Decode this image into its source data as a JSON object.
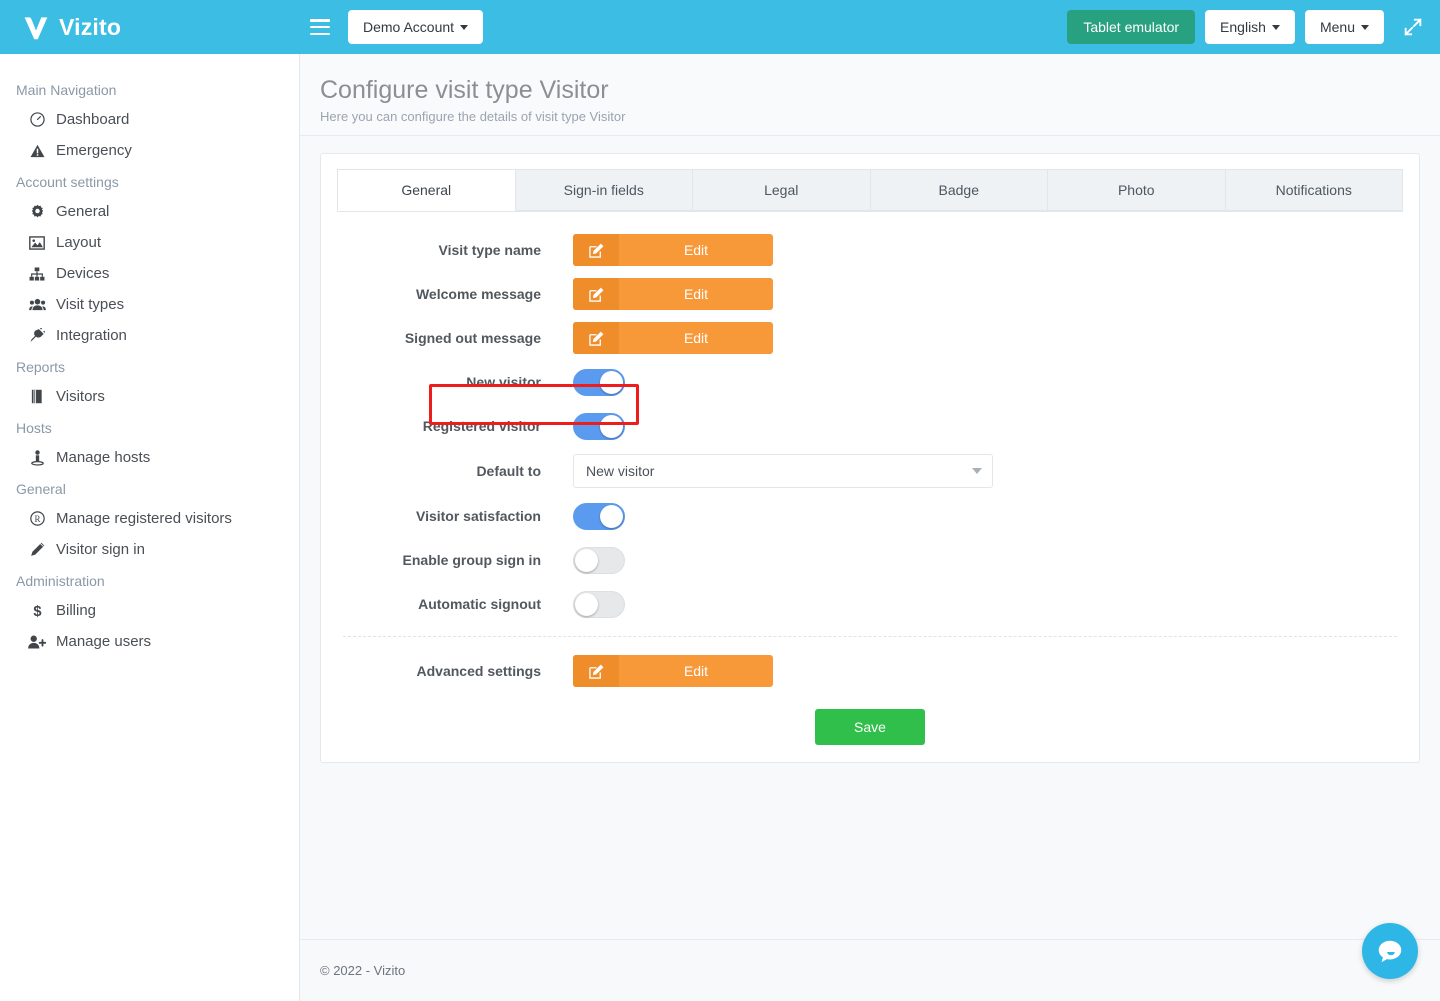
{
  "topbar": {
    "brand": "Vizito",
    "account_label": "Demo Account",
    "emulator_label": "Tablet emulator",
    "language_label": "English",
    "menu_label": "Menu"
  },
  "sidebar": {
    "groups": [
      {
        "heading": "Main Navigation",
        "items": [
          {
            "label": "Dashboard",
            "icon": "dashboard-icon"
          },
          {
            "label": "Emergency",
            "icon": "warning-icon"
          }
        ]
      },
      {
        "heading": "Account settings",
        "items": [
          {
            "label": "General",
            "icon": "gear-icon"
          },
          {
            "label": "Layout",
            "icon": "image-icon"
          },
          {
            "label": "Devices",
            "icon": "sitemap-icon"
          },
          {
            "label": "Visit types",
            "icon": "users-icon"
          },
          {
            "label": "Integration",
            "icon": "plug-icon"
          }
        ]
      },
      {
        "heading": "Reports",
        "items": [
          {
            "label": "Visitors",
            "icon": "book-icon"
          }
        ]
      },
      {
        "heading": "Hosts",
        "items": [
          {
            "label": "Manage hosts",
            "icon": "person-icon"
          }
        ]
      },
      {
        "heading": "General",
        "items": [
          {
            "label": "Manage registered visitors",
            "icon": "registered-icon"
          },
          {
            "label": "Visitor sign in",
            "icon": "pencil-icon"
          }
        ]
      },
      {
        "heading": "Administration",
        "items": [
          {
            "label": "Billing",
            "icon": "dollar-icon"
          },
          {
            "label": "Manage users",
            "icon": "user-plus-icon"
          }
        ]
      }
    ]
  },
  "page": {
    "title": "Configure visit type Visitor",
    "subtitle": "Here you can configure the details of visit type Visitor"
  },
  "tabs": [
    {
      "label": "General",
      "active": true
    },
    {
      "label": "Sign-in fields",
      "active": false
    },
    {
      "label": "Legal",
      "active": false
    },
    {
      "label": "Badge",
      "active": false
    },
    {
      "label": "Photo",
      "active": false
    },
    {
      "label": "Notifications",
      "active": false
    }
  ],
  "form": {
    "edit_label": "Edit",
    "rows": [
      {
        "label": "Visit type name",
        "type": "edit"
      },
      {
        "label": "Welcome message",
        "type": "edit"
      },
      {
        "label": "Signed out message",
        "type": "edit"
      },
      {
        "label": "New visitor",
        "type": "toggle",
        "on": true
      },
      {
        "label": "Registered visitor",
        "type": "toggle",
        "on": true,
        "highlighted": true
      },
      {
        "label": "Default to",
        "type": "select",
        "value": "New visitor"
      },
      {
        "label": "Visitor satisfaction",
        "type": "toggle",
        "on": true
      },
      {
        "label": "Enable group sign in",
        "type": "toggle",
        "on": false
      },
      {
        "label": "Automatic signout",
        "type": "toggle",
        "on": false
      }
    ],
    "advanced": {
      "label": "Advanced settings",
      "type": "edit"
    },
    "save_label": "Save"
  },
  "footer": {
    "copyright": "© 2022 - Vizito"
  },
  "colors": {
    "brand_blue": "#3bbde4",
    "accent_orange": "#f79839",
    "toggle_on": "#5b9bef",
    "save_green": "#2fbf4a",
    "emulator_green": "#27a17f",
    "highlight_red": "#ee1c1c"
  }
}
